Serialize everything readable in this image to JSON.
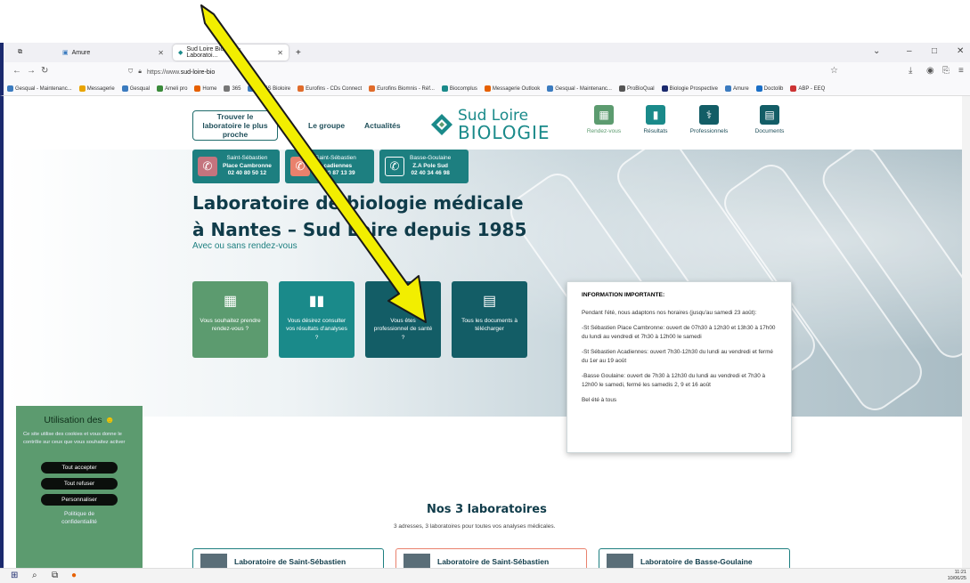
{
  "browser": {
    "tabs": [
      {
        "label": "Amure",
        "active": false
      },
      {
        "label": "Sud Loire Biologie - Laboratoi...",
        "active": true
      }
    ],
    "new_tab_label": "+",
    "url_prefix": "https://www.",
    "url_domain": "sud-loire-bio",
    "bookmarks": [
      "Gesqual - Maintenanc...",
      "Messagerie",
      "Gesqual",
      "Ameli pro",
      "Home",
      "365",
      "ORES Bioloire",
      "Eurofins - CDs Connect",
      "Eurofins Biomnis - Réf...",
      "Biocomplus",
      "Messagerie Outlook",
      "Gesqual - Maintenanc...",
      "ProBioQual",
      "Biologie Prospective",
      "Amure",
      "Doctolib",
      "ABP - EEQ"
    ]
  },
  "header": {
    "find_lab": "Trouver le laboratoire le plus proche",
    "nav": [
      "Le groupe",
      "Actualités"
    ],
    "logo_line1": "Sud Loire",
    "logo_line2": "BIOLOGIE",
    "quick_links": [
      {
        "label": "Rendez-vous",
        "color": "#5c9b6f",
        "icon": "calendar-icon"
      },
      {
        "label": "Résultats",
        "color": "#1a8a8a",
        "icon": "bar-chart-icon"
      },
      {
        "label": "Professionnels",
        "color": "#135d66",
        "icon": "stethoscope-icon"
      },
      {
        "label": "Documents",
        "color": "#135d66",
        "icon": "document-icon"
      }
    ]
  },
  "phones": [
    {
      "name": "Saint-Sébastien",
      "site": "Place Cambronne",
      "number": "02 40 80 50 12",
      "color": "#1d7f80",
      "icon_color": "#c4747e"
    },
    {
      "name": "Saint-Sébastien",
      "site": "Acadiennes",
      "number": "02 40 87 13 39",
      "color": "#1d7f80",
      "icon_color": "#e9816d"
    },
    {
      "name": "Basse-Goulaine",
      "site": "Z.A Pole Sud",
      "number": "02 40 34 46 98",
      "color": "#1d7f80",
      "icon_color": "#1d7f80"
    }
  ],
  "hero": {
    "title_line1": "Laboratoire de biologie médicale",
    "title_line2": "à Nantes – Sud Loire depuis 1985",
    "subtitle": "Avec ou sans rendez-vous"
  },
  "cards": [
    {
      "text": "Vous souhaitez prendre rendez-vous ?",
      "color": "#5c9b6f",
      "icon": "calendar-icon"
    },
    {
      "text": "Vous désirez consulter vos résultats d'analyses ?",
      "color": "#1a8a8a",
      "icon": "bar-chart-icon"
    },
    {
      "text": "Vous êtes professionnel de santé ?",
      "color": "#135d66",
      "icon": "stethoscope-icon"
    },
    {
      "text": "Tous les documents à télécharger",
      "color": "#135d66",
      "icon": "document-icon"
    }
  ],
  "info": {
    "heading": "INFORMATION IMPORTANTE:",
    "paragraphs": [
      "Pendant l'été, nous adaptons nos horaires (jusqu'au samedi 23 août):",
      "-St Sébastien Place Cambronne: ouvert de 07h30 à 12h30 et 13h30 à 17h00 du lundi au vendredi et 7h30 à 12h00 le samedi",
      "-St Sébastien Acadiennes: ouvert 7h30-12h30 du lundi au vendredi et fermé du 1er au 19 août",
      "-Basse Goulaine: ouvert de 7h30 à 12h30 du lundi au vendredi et 7h30 à 12h00 le samedi, fermé les samedis 2, 9 et 16 août",
      "Bel été à tous"
    ]
  },
  "cookie": {
    "title": "Utilisation des",
    "text": "Ce site utilise des cookies et vous donne le contrôle sur ceux que vous souhaitez activer",
    "accept": "Tout accepter",
    "refuse": "Tout refuser",
    "customize": "Personnaliser",
    "policy": "Politique de confidentialité"
  },
  "labs": {
    "title": "Nos 3 laboratoires",
    "subtitle": "3 adresses, 3 laboratoires pour toutes vos analyses médicales.",
    "items": [
      {
        "name": "Laboratoire de Saint-Sébastien",
        "border": "#1d7f80"
      },
      {
        "name": "Laboratoire de Saint-Sébastien",
        "border": "#e9816d"
      },
      {
        "name": "Laboratoire de Basse-Goulaine",
        "border": "#1d7f80"
      }
    ]
  },
  "taskbar": {
    "time": "11:21",
    "date": "10/06/25"
  },
  "colors": {
    "annotation_arrow": "#f2ee00",
    "brand_teal": "#1a8a8a",
    "brand_dark": "#103c4a"
  }
}
